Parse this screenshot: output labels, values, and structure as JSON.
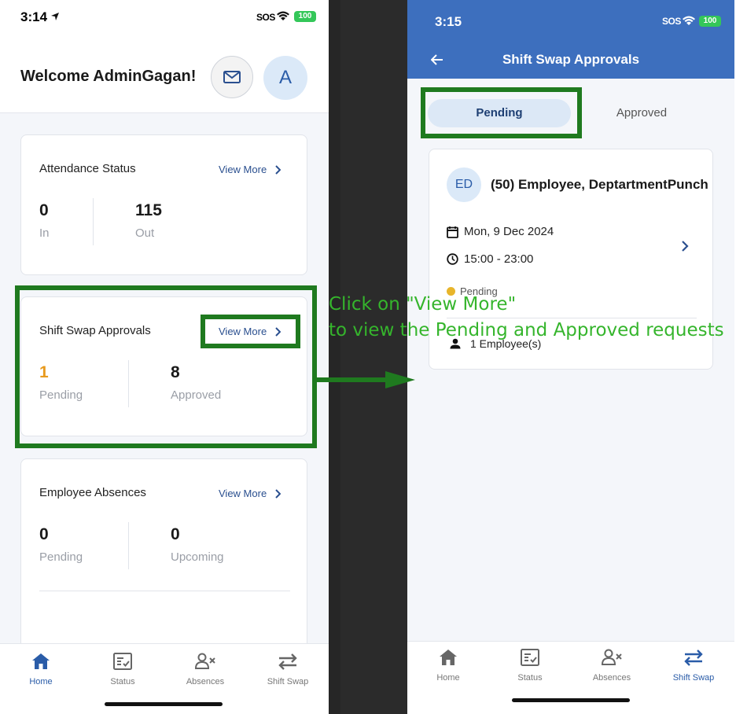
{
  "left_phone": {
    "status_bar": {
      "time": "3:14",
      "sos": "SOS",
      "battery": "100"
    },
    "welcome": "Welcome AdminGagan!",
    "avatar_letter": "A",
    "attendance": {
      "title": "Attendance Status",
      "view_more": "View More",
      "in_value": "0",
      "in_label": "In",
      "out_value": "115",
      "out_label": "Out"
    },
    "shift_swap": {
      "title": "Shift Swap Approvals",
      "view_more": "View More",
      "pending_value": "1",
      "pending_label": "Pending",
      "approved_value": "8",
      "approved_label": "Approved"
    },
    "absences": {
      "title": "Employee Absences",
      "view_more": "View More",
      "pending_value": "0",
      "pending_label": "Pending",
      "upcoming_value": "0",
      "upcoming_label": "Upcoming"
    },
    "tabs": [
      "Home",
      "Status",
      "Absences",
      "Shift Swap"
    ]
  },
  "right_phone": {
    "status_bar": {
      "time": "3:15",
      "sos": "SOS",
      "battery": "100"
    },
    "title": "Shift Swap Approvals",
    "segments": {
      "pending": "Pending",
      "approved": "Approved"
    },
    "request": {
      "initials": "ED",
      "name": "(50) Employee, DeptartmentPunch",
      "date": "Mon, 9 Dec 2024",
      "time": "15:00 - 23:00",
      "status": "Pending",
      "employees": "1 Employee(s)"
    },
    "tabs": [
      "Home",
      "Status",
      "Absences",
      "Shift Swap"
    ]
  },
  "annotation": {
    "line1": "Click on \"View More\"",
    "line2": "to view the Pending and Approved requests"
  },
  "colors": {
    "accent_blue": "#3d6fbe",
    "highlight_green": "#1f7a1f",
    "annotation_text": "#35b52c",
    "pending_orange": "#e89a1d"
  }
}
